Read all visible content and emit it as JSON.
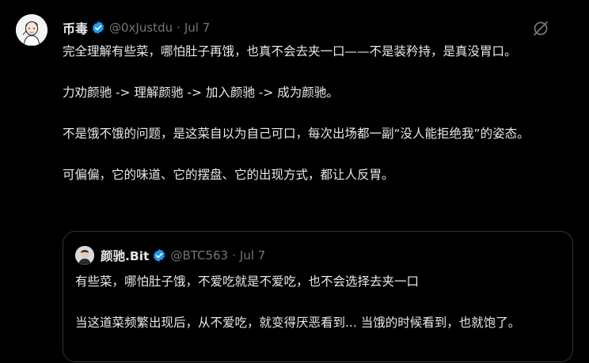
{
  "tweet": {
    "author_name": "币毒",
    "author_handle": "@0xJustdu",
    "separator": "·",
    "date": "Jul 7",
    "paragraphs": [
      "完全理解有些菜，哪怕肚子再饿，也真不会去夹一口——不是装矜持，是真没胃口。",
      "力劝颜驰 -> 理解颜驰 -> 加入颜驰 -> 成为颜驰。",
      "不是饿不饿的问题，是这菜自以为自己可口，每次出场都一副“没人能拒绝我”的姿态。",
      "可偏偏，它的味道、它的摆盘、它的出现方式，都让人反胃。"
    ]
  },
  "quoted_tweet": {
    "author_name": "颜驰.Bit",
    "author_handle": "@BTC563",
    "separator": "·",
    "date": "Jul 7",
    "paragraphs": [
      "有些菜，哪怕肚子饿，不爱吃就是不爱吃，也不会选择去夹一口",
      "当这道菜频繁出现后，从不爱吃，就变得厌恶看到... 当饿的时候看到，也就饱了。"
    ]
  },
  "icons": {
    "verified": "verified-badge-icon",
    "grok": "grok-icon"
  },
  "colors": {
    "background": "#000000",
    "text": "#e7e9ea",
    "muted": "#71767b",
    "verified": "#1d9bf0",
    "border": "#2f3336"
  }
}
